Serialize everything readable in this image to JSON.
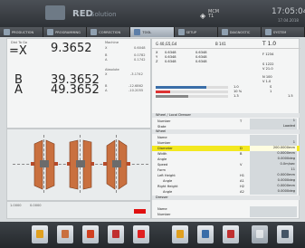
{
  "header": {
    "brand": "RED",
    "brand_sub": "Solution",
    "mcm": "MCM",
    "mcm_sub": "T1",
    "clock": "17:05:04",
    "date": "17.04.2018"
  },
  "tabs": [
    {
      "label": "PRODUCTION"
    },
    {
      "label": "PROGRAMMING"
    },
    {
      "label": "CORRECTION"
    },
    {
      "label": "TOOL"
    },
    {
      "label": "SETUP"
    },
    {
      "label": "DIAGNOSTIC"
    },
    {
      "label": "SYSTEM"
    }
  ],
  "position": {
    "dist_label": "Dist To Go",
    "machine_label": "Machine",
    "absolute_label": "Absolute",
    "main_axis": "=X",
    "main_value": "9.3652",
    "machine": [
      {
        "axis": "X",
        "value": "0.6048"
      },
      {
        "axis": "B",
        "value": "0.0782"
      },
      {
        "axis": "A",
        "value": "0.1742"
      }
    ],
    "absolute": [
      {
        "axis": "X",
        "value": "-3.1742"
      },
      {
        "axis": "B",
        "value": "-12.6862"
      },
      {
        "axis": "A",
        "value": "-10.2055"
      }
    ],
    "b_axis": "B",
    "b_value": "39.3652",
    "a_axis": "A",
    "a_value": "49.3652"
  },
  "right_panel": {
    "g_codes": "G 40,G5,G4",
    "b_label": "B 141",
    "t_label": "T 1.0",
    "coords_left": [
      "X",
      "Y",
      "Z"
    ],
    "coords_left_vals": [
      "0.6348",
      "0.6348",
      "0.6348"
    ],
    "coords_right_vals": [
      "0.6348",
      "0.6348",
      "0.6348"
    ],
    "f_label": "F 1234",
    "s_label": "S 1222",
    "v_label": "V 21.0",
    "n_label": "N 100",
    "v1_label": "V 1.0",
    "bar_vals": [
      "1.0",
      "10 %",
      "1.3"
    ],
    "side_vals": [
      "S",
      "1",
      "1.5"
    ]
  },
  "wheel_section": {
    "title": "Wheel / Local Dresser",
    "rows": [
      {
        "label": "Number",
        "sym": "T",
        "value": "1"
      },
      {
        "label": "State",
        "sym": "",
        "value": "Loaded"
      }
    ]
  },
  "wheel": {
    "title": "Wheel",
    "rows": [
      {
        "label": "Name",
        "sym": "",
        "value": ""
      },
      {
        "label": "Number",
        "sym": "",
        "value": "1"
      },
      {
        "label": "Diameter",
        "sym": "D",
        "value": "200.0000mm"
      },
      {
        "label": "Width",
        "sym": "B",
        "value": "0.0000mm"
      },
      {
        "label": "Angle",
        "sym": "",
        "value": "0.0000deg"
      },
      {
        "label": "Speed",
        "sym": "V",
        "value": "0.0m/sec"
      },
      {
        "label": "Form",
        "sym": "",
        "value": "11"
      },
      {
        "label": "Left Height",
        "sym": "H1",
        "value": "0.0000mm"
      },
      {
        "label": "Angle",
        "sym": "A1",
        "value": "0.0000deg"
      },
      {
        "label": "Right Height",
        "sym": "H2",
        "value": "0.0000mm"
      },
      {
        "label": "Angle",
        "sym": "A2",
        "value": "0.0000deg"
      }
    ]
  },
  "dresser": {
    "title": "Dresser",
    "rows": [
      {
        "label": "Name",
        "sym": "",
        "value": ""
      },
      {
        "label": "Number",
        "sym": "",
        "value": ""
      }
    ]
  },
  "tool_view": {
    "scale": "1.0000",
    "offset": "0.0000"
  },
  "colors": {
    "highlight": "#f3e820",
    "tool_body": "#c9703f",
    "accent_red": "#e01010"
  }
}
